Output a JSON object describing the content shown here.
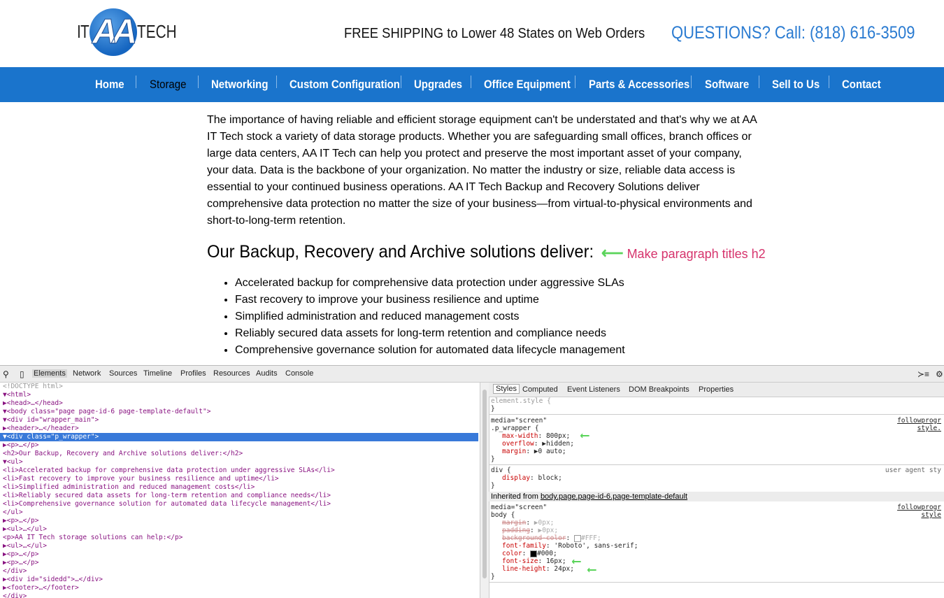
{
  "header": {
    "logo_left": "IT",
    "logo_mid": "AA",
    "logo_right": "TECH",
    "shipping": "FREE SHIPPING to Lower 48 States on Web Orders",
    "questions": "QUESTIONS? Call: (818) 616-3509"
  },
  "nav": {
    "items": [
      "Home",
      "Storage",
      "Networking",
      "Custom Configuration",
      "Upgrades",
      "Office Equipment",
      "Parts & Accessories",
      "Software",
      "Sell to Us",
      "Contact"
    ],
    "active": "Storage"
  },
  "content": {
    "intro_lines": [
      "The importance of having reliable and efficient storage equipment can't be understated and that's why we at AA",
      "IT Tech stock a variety of data storage products. Whether you are safeguarding small offices, branch offices or",
      "large data centers, AA IT Tech can help you protect and preserve the most important asset of your company,",
      "your data. Data is the backbone of your organization. No matter the industry or size, reliable data access is",
      "essential to your continued business operations. AA IT Tech Backup and Recovery Solutions deliver",
      "comprehensive data protection no matter the size of your business—from virtual-to-physical environments and",
      "short-to-long-term retention."
    ],
    "heading": "Our Backup, Recovery and Archive solutions deliver:",
    "annotation": "Make paragraph titles h2",
    "bullets": [
      "Accelerated backup for comprehensive data protection under aggressive SLAs",
      "Fast recovery to improve your business resilience and uptime",
      "Simplified administration and reduced management costs",
      "Reliably secured data assets for long-term retention and compliance needs",
      "Comprehensive governance solution for automated data lifecycle management"
    ]
  },
  "devtools": {
    "tabs": [
      "Elements",
      "Network",
      "Sources",
      "Timeline",
      "Profiles",
      "Resources",
      "Audits",
      "Console"
    ],
    "active_tab": "Elements",
    "dom_lines": [
      "<!DOCTYPE html>",
      "▼<html>",
      "  ▶<head>…</head>",
      "  ▼<body class=\"page page-id-6 page-template-default\">",
      "    ▼<div id=\"wrapper_main\">",
      "      ▶<header>…</header>",
      "      ▼<div class=\"p_wrapper\">",
      "        ▶<p>…</p>",
      "          <h2>Our Backup, Recovery and Archive solutions deliver:</h2>",
      "        ▼<ul>",
      "            <li>Accelerated backup for comprehensive data protection under aggressive SLAs</li>",
      "            <li>Fast recovery to improve your business resilience and uptime</li>",
      "            <li>Simplified administration and reduced management costs</li>",
      "            <li>Reliably secured data assets for long-term retention and compliance needs</li>",
      "            <li>Comprehensive governance solution for automated data lifecycle management</li>",
      "          </ul>",
      "        ▶<p>…</p>",
      "        ▶<ul>…</ul>",
      "          <p>AA IT Tech storage solutions can help:</p>",
      "        ▶<ul>…</ul>",
      "        ▶<p>…</p>",
      "        ▶<p>…</p>",
      "        </div>",
      "      ▶<div id=\"sidedd\">…</div>",
      "      ▶<footer>…</footer>",
      "      </div>"
    ],
    "selected_line": 6,
    "style_tabs": [
      "Styles",
      "Computed",
      "Event Listeners",
      "DOM Breakpoints",
      "Properties"
    ],
    "active_style_tab": "Styles",
    "rule1": {
      "media": "media=\"screen\"",
      "selector": ".p_wrapper {",
      "source": "followprogr style.",
      "props": [
        {
          "name": "max-width",
          "value": "800px;"
        },
        {
          "name": "overflow",
          "value": "▶hidden;"
        },
        {
          "name": "margin",
          "value": "▶0 auto;"
        }
      ],
      "close": "}"
    },
    "rule2": {
      "selector": "div {",
      "source": "user agent sty",
      "props": [
        {
          "name": "display",
          "value": "block;"
        }
      ],
      "close": "}"
    },
    "inherited_label": "Inherited from",
    "inherited_from": "body.page.page-id-6.page-template-default",
    "rule3": {
      "media": "media=\"screen\"",
      "selector": "body {",
      "source": "followprogr style",
      "props": [
        {
          "name": "margin",
          "value": "▶0px;",
          "dim": true
        },
        {
          "name": "padding",
          "value": "▶0px;",
          "dim": true
        },
        {
          "name": "background-color",
          "value": "#FFF;",
          "dim": true
        },
        {
          "name": "font-family",
          "value": "'Roboto', sans-serif;"
        },
        {
          "name": "color",
          "value": "#000;"
        },
        {
          "name": "font-size",
          "value": "16px;"
        },
        {
          "name": "line-height",
          "value": "24px;"
        }
      ],
      "close": "}"
    },
    "top_close": "}",
    "element_style_label": "element.style {"
  },
  "colors": {
    "nav_bg": "#1a74cc",
    "accent_blue": "#2a7bd1",
    "annotation": "#d6336c",
    "arrow_green": "#5bd45b"
  }
}
